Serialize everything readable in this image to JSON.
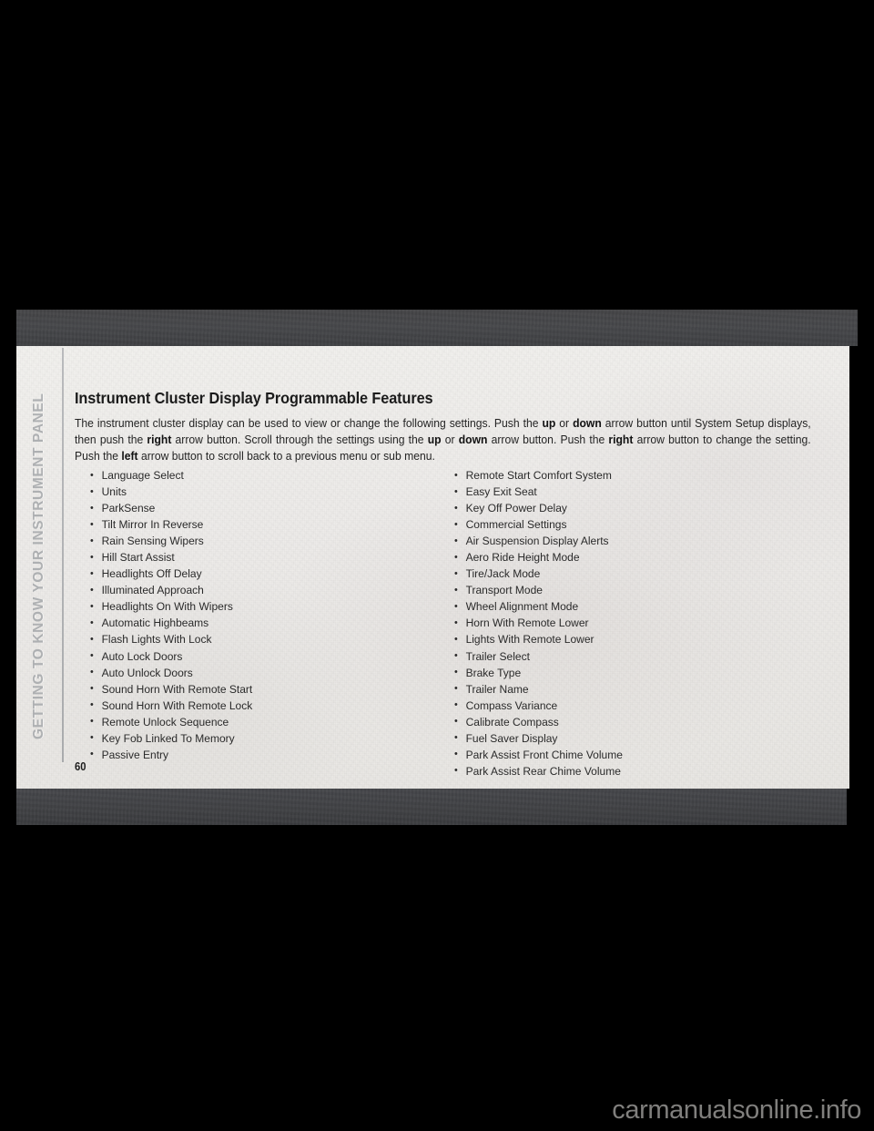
{
  "document": {
    "chapter_tab": "GETTING TO KNOW YOUR INSTRUMENT PANEL",
    "page_number": "60",
    "watermark": "carmanualsonline.info"
  },
  "section": {
    "title": "Instrument Cluster Display Programmable Features",
    "paragraph": {
      "p1": "The instrument cluster display can be used to view or change the following settings. Push the ",
      "b1": "up",
      "p2": " or ",
      "b2": "down",
      "p3": " arrow button until System Setup displays, then push the ",
      "b3": "right",
      "p4": " arrow button. Scroll through the settings using the ",
      "b4": "up",
      "p5": " or ",
      "b5": "down",
      "p6": " arrow button. Push the ",
      "b6": "right",
      "p7": " arrow button to change the setting. Push the ",
      "b7": "left",
      "p8": " arrow button to scroll back to a previous menu or sub menu."
    }
  },
  "features": {
    "column_left": [
      "Language Select",
      "Units",
      "ParkSense",
      "Tilt Mirror In Reverse",
      "Rain Sensing Wipers",
      "Hill Start Assist",
      "Headlights Off Delay",
      "Illuminated Approach",
      "Headlights On With Wipers",
      "Automatic Highbeams",
      "Flash Lights With Lock",
      "Auto Lock Doors",
      "Auto Unlock Doors",
      "Sound Horn With Remote Start",
      "Sound Horn With Remote Lock",
      "Remote Unlock Sequence",
      "Key Fob Linked To Memory",
      "Passive Entry"
    ],
    "column_right": [
      "Remote Start Comfort System",
      "Easy Exit Seat",
      "Key Off Power Delay",
      "Commercial Settings",
      "Air Suspension Display Alerts",
      "Aero Ride Height Mode",
      "Tire/Jack Mode",
      "Transport Mode",
      "Wheel Alignment Mode",
      "Horn With Remote Lower",
      "Lights With Remote Lower",
      "Trailer Select",
      "Brake Type",
      "Trailer Name",
      "Compass Variance",
      "Calibrate Compass",
      "Fuel Saver Display",
      "Park Assist Front Chime Volume",
      "Park Assist Rear Chime Volume"
    ]
  },
  "colors": {
    "paper": "#eeecea",
    "band": "#44464a",
    "text": "#242424",
    "tab_text": "#aeb0b2",
    "watermark": "#807f7d"
  }
}
